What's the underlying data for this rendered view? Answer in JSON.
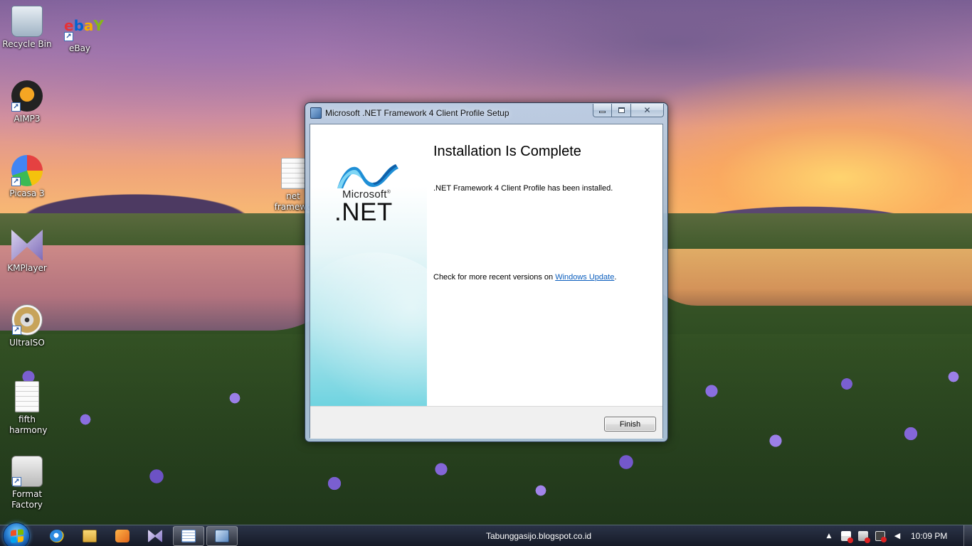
{
  "desktop": {
    "icons": [
      {
        "label": "Recycle Bin",
        "icon": "recycle-bin-icon"
      },
      {
        "label": "eBay",
        "icon": "ebay-icon",
        "shortcut": true
      },
      {
        "label": "AIMP3",
        "icon": "aimp-icon",
        "shortcut": true
      },
      {
        "label": "Picasa 3",
        "icon": "picasa-icon",
        "shortcut": true
      },
      {
        "label": "KMPlayer",
        "icon": "kmplayer-icon",
        "shortcut": true
      },
      {
        "label": "UltraISO",
        "icon": "ultraiso-icon",
        "shortcut": true
      },
      {
        "label": "fifth harmony",
        "icon": "text-document-icon"
      },
      {
        "label": "Format Factory",
        "icon": "format-factory-icon",
        "shortcut": true
      },
      {
        "label": "net framewo",
        "icon": "text-document-icon"
      }
    ]
  },
  "dialog": {
    "title": "Microsoft .NET Framework 4 Client Profile Setup",
    "logo": {
      "brand": "Microsoft",
      "registered": "®",
      "product": ".NET",
      "colors": {
        "wave_light": "#5bc8f0",
        "wave_dark": "#0f5fa8"
      }
    },
    "heading": "Installation Is Complete",
    "installed_message": ".NET Framework 4 Client Profile has been installed.",
    "update_prefix": "Check for more recent versions on ",
    "update_link": "Windows Update",
    "update_suffix": ".",
    "finish_label": "Finish",
    "caption": {
      "close_glyph": "✕"
    }
  },
  "taskbar": {
    "center_text": "Tabunggasijo.blogspot.co.id",
    "pinned": [
      {
        "name": "internet-explorer",
        "icon": "internet-explorer-icon"
      },
      {
        "name": "windows-explorer",
        "icon": "folder-icon"
      },
      {
        "name": "media-player",
        "icon": "media-player-icon"
      },
      {
        "name": "kmplayer",
        "icon": "kmplayer-icon"
      },
      {
        "name": "notepad",
        "icon": "notepad-icon",
        "active": true
      },
      {
        "name": "setup",
        "icon": "setup-icon",
        "active": true
      }
    ],
    "tray": {
      "chevron": "▲",
      "volume_glyph": "◀"
    },
    "clock": "10:09 PM"
  }
}
